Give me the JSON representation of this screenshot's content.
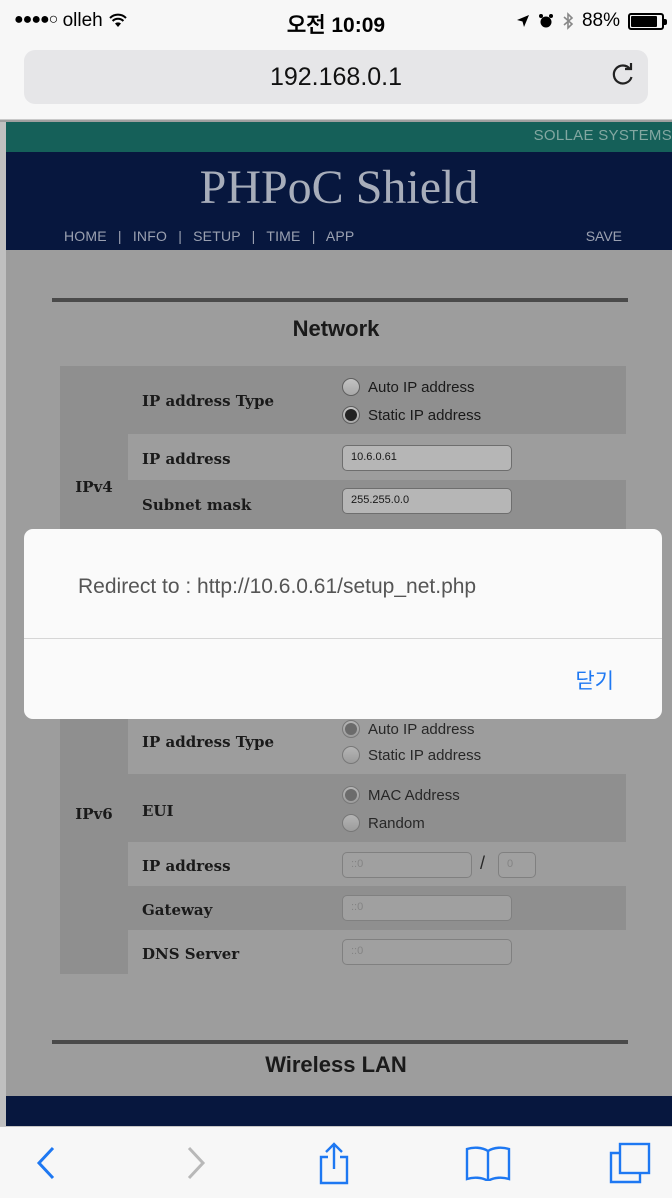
{
  "status_bar": {
    "signal": "●●●●○",
    "carrier": "olleh",
    "time": "오전 10:09",
    "battery": "88%",
    "battery_level": 0.88
  },
  "browser": {
    "url": "192.168.0.1"
  },
  "header": {
    "brand": "SOLLAE SYSTEMS",
    "title": "PHPoC Shield",
    "nav": [
      "HOME",
      "INFO",
      "SETUP",
      "TIME",
      "APP"
    ],
    "nav_separator": "|",
    "save": "SAVE"
  },
  "network": {
    "title": "Network",
    "ipv4": {
      "label": "IPv4",
      "ip_type_label": "IP address Type",
      "option_auto": "Auto IP address",
      "option_static": "Static IP address",
      "selected": "static",
      "ip_address_label": "IP address",
      "ip_address_value": "10.6.0.61",
      "subnet_label": "Subnet mask",
      "subnet_value": "255.255.0.0"
    },
    "ipv6": {
      "label": "IPv6",
      "ip_type_label": "IP address Type",
      "option_auto": "Auto IP address",
      "option_static": "Static IP address",
      "selected": "auto",
      "eui_label": "EUI",
      "option_mac": "MAC Address",
      "option_random": "Random",
      "eui_selected": "mac",
      "ip_address_label": "IP address",
      "ip_address_value": "::0",
      "prefix_separator": "/",
      "prefix_value": "0",
      "gateway_label": "Gateway",
      "gateway_value": "::0",
      "dns_label": "DNS Server",
      "dns_value": "::0"
    }
  },
  "wireless": {
    "title": "Wireless LAN"
  },
  "alert": {
    "message": "Redirect to : http://10.6.0.61/setup_net.php",
    "close_label": "닫기"
  },
  "toolbar": {
    "icons": [
      "back-icon",
      "forward-icon",
      "share-icon",
      "bookmarks-icon",
      "tabs-icon"
    ]
  }
}
